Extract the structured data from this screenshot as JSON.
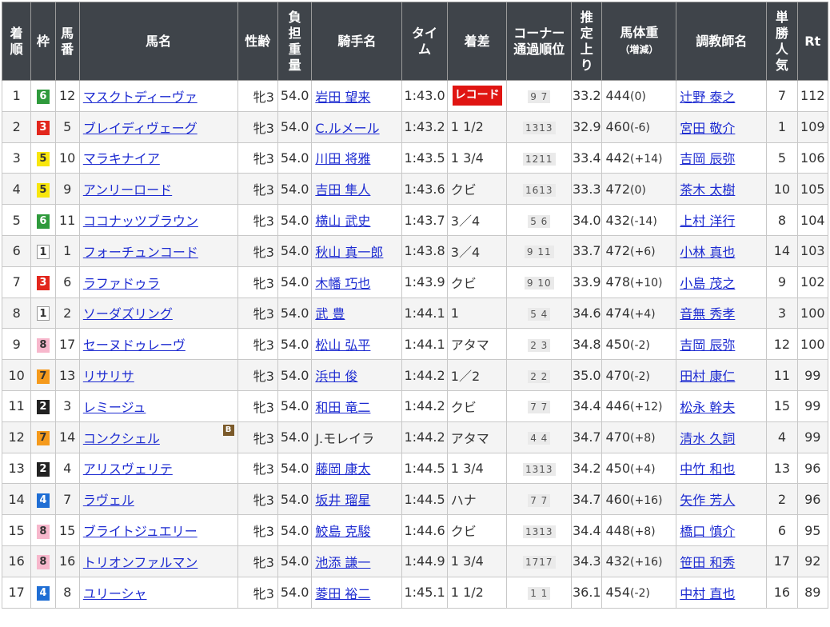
{
  "headers": {
    "rank": [
      "着",
      "順"
    ],
    "waku": "枠",
    "umaban": [
      "馬",
      "番"
    ],
    "horse": "馬名",
    "sexage": "性齢",
    "weight": [
      "負",
      "担",
      "重",
      "量"
    ],
    "jockey": "騎手名",
    "time": [
      "タイ",
      "ム"
    ],
    "margin": "着差",
    "corner": [
      "コーナー",
      "通過順位"
    ],
    "last3f": [
      "推",
      "定",
      "上",
      "り"
    ],
    "bodyweight": [
      "馬体重",
      "（増減）"
    ],
    "trainer": "調教師名",
    "pop": [
      "単",
      "勝",
      "人",
      "気"
    ],
    "rt": "Rt"
  },
  "colors": {
    "header_bg": "#3f444a",
    "link": "#1d2bd1",
    "record_badge": "#e01512"
  },
  "rows": [
    {
      "rank": "1",
      "waku": "6",
      "num": "12",
      "horse": "マスクトディーヴァ",
      "sexage": "牝3",
      "wt": "54.0",
      "jockey": "岩田 望来",
      "jockey_link": true,
      "time": "1:43.0",
      "margin": "レコード",
      "margin_record": true,
      "corner": "9 7",
      "last3f": "33.2",
      "bw": "444",
      "bwc": "(0)",
      "trainer": "辻野 泰之",
      "pop": "7",
      "rt": "112",
      "bicon": false
    },
    {
      "rank": "2",
      "waku": "3",
      "num": "5",
      "horse": "ブレイディヴェーグ",
      "sexage": "牝3",
      "wt": "54.0",
      "jockey": "C.ルメール",
      "jockey_link": true,
      "time": "1:43.2",
      "margin": "1 1/2",
      "margin_record": false,
      "corner": "1313",
      "last3f": "32.9",
      "bw": "460",
      "bwc": "(-6)",
      "trainer": "宮田 敬介",
      "pop": "1",
      "rt": "109",
      "bicon": false
    },
    {
      "rank": "3",
      "waku": "5",
      "num": "10",
      "horse": "マラキナイア",
      "sexage": "牝3",
      "wt": "54.0",
      "jockey": "川田 将雅",
      "jockey_link": true,
      "time": "1:43.5",
      "margin": "1 3/4",
      "margin_record": false,
      "corner": "1211",
      "last3f": "33.4",
      "bw": "442",
      "bwc": "(+14)",
      "trainer": "吉岡 辰弥",
      "pop": "5",
      "rt": "106",
      "bicon": false
    },
    {
      "rank": "4",
      "waku": "5",
      "num": "9",
      "horse": "アンリーロード",
      "sexage": "牝3",
      "wt": "54.0",
      "jockey": "吉田 隼人",
      "jockey_link": true,
      "time": "1:43.6",
      "margin": "クビ",
      "margin_record": false,
      "corner": "1613",
      "last3f": "33.3",
      "bw": "472",
      "bwc": "(0)",
      "trainer": "茶木 太樹",
      "pop": "10",
      "rt": "105",
      "bicon": false
    },
    {
      "rank": "5",
      "waku": "6",
      "num": "11",
      "horse": "ココナッツブラウン",
      "sexage": "牝3",
      "wt": "54.0",
      "jockey": "横山 武史",
      "jockey_link": true,
      "time": "1:43.7",
      "margin": "3／4",
      "margin_record": false,
      "corner": "5 6",
      "last3f": "34.0",
      "bw": "432",
      "bwc": "(-14)",
      "trainer": "上村 洋行",
      "pop": "8",
      "rt": "104",
      "bicon": false
    },
    {
      "rank": "6",
      "waku": "1",
      "num": "1",
      "horse": "フォーチュンコード",
      "sexage": "牝3",
      "wt": "54.0",
      "jockey": "秋山 真一郎",
      "jockey_link": true,
      "time": "1:43.8",
      "margin": "3／4",
      "margin_record": false,
      "corner": "9 11",
      "last3f": "33.7",
      "bw": "472",
      "bwc": "(+6)",
      "trainer": "小林 真也",
      "pop": "14",
      "rt": "103",
      "bicon": false
    },
    {
      "rank": "7",
      "waku": "3",
      "num": "6",
      "horse": "ラファドゥラ",
      "sexage": "牝3",
      "wt": "54.0",
      "jockey": "木幡 巧也",
      "jockey_link": true,
      "time": "1:43.9",
      "margin": "クビ",
      "margin_record": false,
      "corner": "9 10",
      "last3f": "33.9",
      "bw": "478",
      "bwc": "(+10)",
      "trainer": "小島 茂之",
      "pop": "9",
      "rt": "102",
      "bicon": false
    },
    {
      "rank": "8",
      "waku": "1",
      "num": "2",
      "horse": "ソーダズリング",
      "sexage": "牝3",
      "wt": "54.0",
      "jockey": "武 豊",
      "jockey_link": true,
      "time": "1:44.1",
      "margin": "1",
      "margin_record": false,
      "corner": "5 4",
      "last3f": "34.6",
      "bw": "474",
      "bwc": "(+4)",
      "trainer": "音無 秀孝",
      "pop": "3",
      "rt": "100",
      "bicon": false
    },
    {
      "rank": "9",
      "waku": "8",
      "num": "17",
      "horse": "セーヌドゥレーヴ",
      "sexage": "牝3",
      "wt": "54.0",
      "jockey": "松山 弘平",
      "jockey_link": true,
      "time": "1:44.1",
      "margin": "アタマ",
      "margin_record": false,
      "corner": "2 3",
      "last3f": "34.8",
      "bw": "450",
      "bwc": "(-2)",
      "trainer": "吉岡 辰弥",
      "pop": "12",
      "rt": "100",
      "bicon": false
    },
    {
      "rank": "10",
      "waku": "7",
      "num": "13",
      "horse": "リサリサ",
      "sexage": "牝3",
      "wt": "54.0",
      "jockey": "浜中 俊",
      "jockey_link": true,
      "time": "1:44.2",
      "margin": "1／2",
      "margin_record": false,
      "corner": "2 2",
      "last3f": "35.0",
      "bw": "470",
      "bwc": "(-2)",
      "trainer": "田村 康仁",
      "pop": "11",
      "rt": "99",
      "bicon": false
    },
    {
      "rank": "11",
      "waku": "2",
      "num": "3",
      "horse": "レミージュ",
      "sexage": "牝3",
      "wt": "54.0",
      "jockey": "和田 竜二",
      "jockey_link": true,
      "time": "1:44.2",
      "margin": "クビ",
      "margin_record": false,
      "corner": "7 7",
      "last3f": "34.4",
      "bw": "446",
      "bwc": "(+12)",
      "trainer": "松永 幹夫",
      "pop": "15",
      "rt": "99",
      "bicon": false
    },
    {
      "rank": "12",
      "waku": "7",
      "num": "14",
      "horse": "コンクシェル",
      "sexage": "牝3",
      "wt": "54.0",
      "jockey": "J.モレイラ",
      "jockey_link": false,
      "time": "1:44.2",
      "margin": "アタマ",
      "margin_record": false,
      "corner": "4 4",
      "last3f": "34.7",
      "bw": "470",
      "bwc": "(+8)",
      "trainer": "清水 久詞",
      "pop": "4",
      "rt": "99",
      "bicon": true,
      "bicon_text": "B"
    },
    {
      "rank": "13",
      "waku": "2",
      "num": "4",
      "horse": "アリスヴェリテ",
      "sexage": "牝3",
      "wt": "54.0",
      "jockey": "藤岡 康太",
      "jockey_link": true,
      "time": "1:44.5",
      "margin": "1 3/4",
      "margin_record": false,
      "corner": "1313",
      "last3f": "34.2",
      "bw": "450",
      "bwc": "(+4)",
      "trainer": "中竹 和也",
      "pop": "13",
      "rt": "96",
      "bicon": false
    },
    {
      "rank": "14",
      "waku": "4",
      "num": "7",
      "horse": "ラヴェル",
      "sexage": "牝3",
      "wt": "54.0",
      "jockey": "坂井 瑠星",
      "jockey_link": true,
      "time": "1:44.5",
      "margin": "ハナ",
      "margin_record": false,
      "corner": "7 7",
      "last3f": "34.7",
      "bw": "460",
      "bwc": "(+16)",
      "trainer": "矢作 芳人",
      "pop": "2",
      "rt": "96",
      "bicon": false
    },
    {
      "rank": "15",
      "waku": "8",
      "num": "15",
      "horse": "ブライトジュエリー",
      "sexage": "牝3",
      "wt": "54.0",
      "jockey": "鮫島 克駿",
      "jockey_link": true,
      "time": "1:44.6",
      "margin": "クビ",
      "margin_record": false,
      "corner": "1313",
      "last3f": "34.4",
      "bw": "448",
      "bwc": "(+8)",
      "trainer": "橋口 慎介",
      "pop": "6",
      "rt": "95",
      "bicon": false
    },
    {
      "rank": "16",
      "waku": "8",
      "num": "16",
      "horse": "トリオンファルマン",
      "sexage": "牝3",
      "wt": "54.0",
      "jockey": "池添 謙一",
      "jockey_link": true,
      "time": "1:44.9",
      "margin": "1 3/4",
      "margin_record": false,
      "corner": "1717",
      "last3f": "34.3",
      "bw": "432",
      "bwc": "(+16)",
      "trainer": "笹田 和秀",
      "pop": "17",
      "rt": "92",
      "bicon": false
    },
    {
      "rank": "17",
      "waku": "4",
      "num": "8",
      "horse": "ユリーシャ",
      "sexage": "牝3",
      "wt": "54.0",
      "jockey": "菱田 裕二",
      "jockey_link": true,
      "time": "1:45.1",
      "margin": "1 1/2",
      "margin_record": false,
      "corner": "1 1",
      "last3f": "36.1",
      "bw": "454",
      "bwc": "(-2)",
      "trainer": "中村 直也",
      "pop": "16",
      "rt": "89",
      "bicon": false
    }
  ]
}
